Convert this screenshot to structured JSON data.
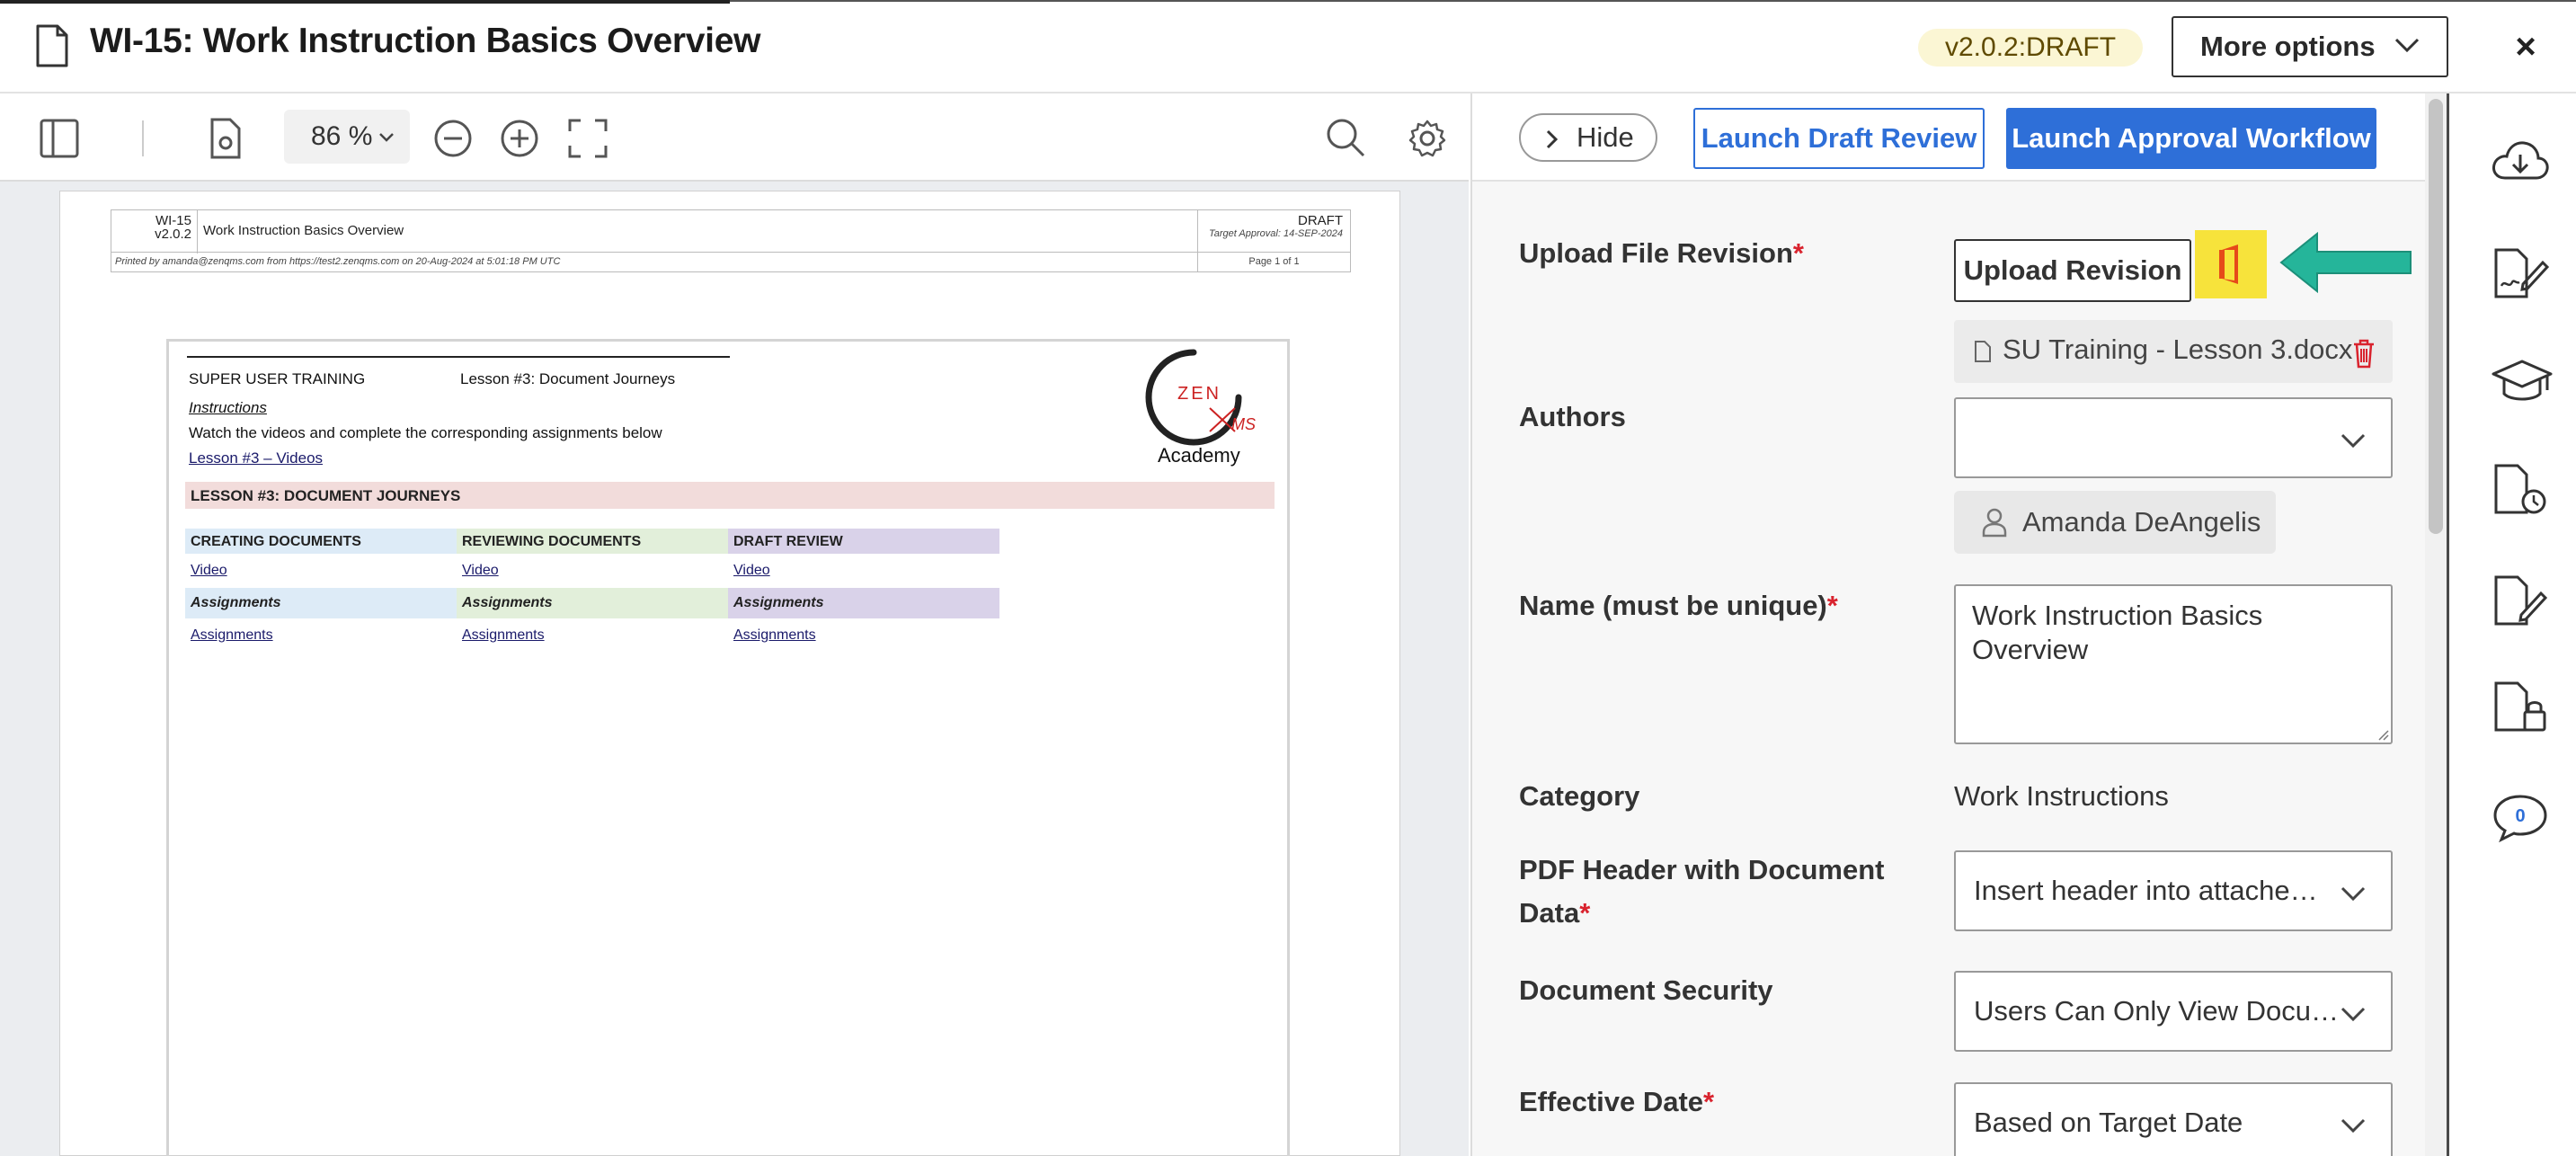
{
  "header": {
    "title": "WI-15: Work Instruction Basics Overview",
    "version": "v2.0.2:DRAFT",
    "more_options": "More options",
    "close": "×"
  },
  "viewer": {
    "zoom": "86 %",
    "pdf_header": {
      "doc_id": "WI-15",
      "doc_version": "v2.0.2",
      "doc_title": "Work Instruction Basics Overview",
      "status": "DRAFT",
      "target": "Target Approval: 14-SEP-2024",
      "printed": "Printed by amanda@zenqms.com from https://test2.zenqms.com on 20-Aug-2024 at 5:01:18 PM UTC",
      "page": "Page 1 of 1"
    },
    "doc": {
      "super_user": "SUPER USER TRAINING",
      "lesson_title": "Lesson #3: Document Journeys",
      "instructions": "Instructions",
      "watch": "Watch the videos and complete the corresponding assignments below",
      "videos_link": "Lesson #3 – Videos",
      "lesson_bar": "LESSON #3: DOCUMENT JOURNEYS",
      "columns": [
        {
          "header": "CREATING DOCUMENTS",
          "video": "Video",
          "assign_h": "Assignments",
          "assign": "Assignments"
        },
        {
          "header": "REVIEWING DOCUMENTS",
          "video": "Video",
          "assign_h": "Assignments",
          "assign": "Assignments"
        },
        {
          "header": "DRAFT REVIEW",
          "video": "Video",
          "assign_h": "Assignments",
          "assign": "Assignments"
        }
      ],
      "logo_text": "ZEN",
      "logo_ms": "MS",
      "logo_academy": "Academy"
    }
  },
  "panel": {
    "hide": "Hide",
    "launch_draft": "Launch Draft Review",
    "launch_approval": "Launch Approval Workflow",
    "upload_label": "Upload File Revision",
    "upload_button": "Upload Revision",
    "file_name": "SU Training - Lesson 3.docx",
    "authors_label": "Authors",
    "author": "Amanda DeAngelis",
    "name_label": "Name (must be unique)",
    "name_value": "Work Instruction Basics Overview",
    "category_label": "Category",
    "category_value": "Work Instructions",
    "pdf_header_label_1": "PDF Header with Document",
    "pdf_header_label_2": "Data",
    "pdf_header_value": "Insert header into attache…",
    "security_label": "Document Security",
    "security_value": "Users Can Only View Docu…",
    "effective_label": "Effective Date",
    "effective_value": "Based on Target Date",
    "required_mark": "*"
  },
  "rail": {
    "comments_count": "0"
  },
  "colors": {
    "accent": "#2e6fd8",
    "office_bg": "#f7e33b",
    "arrow": "#25b59a",
    "required": "#d9232e"
  }
}
